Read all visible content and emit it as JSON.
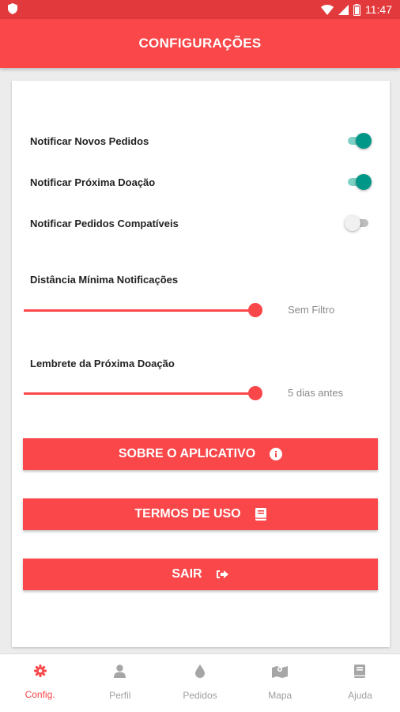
{
  "status": {
    "time": "11:47"
  },
  "appbar": {
    "title": "CONFIGURAÇÕES"
  },
  "settings": {
    "toggles": [
      {
        "label": "Notificar Novos Pedidos",
        "on": true
      },
      {
        "label": "Notificar Próxima Doação",
        "on": true
      },
      {
        "label": "Notificar Pedidos Compatíveis",
        "on": false
      }
    ],
    "distance": {
      "label": "Distância Mínima Notificações",
      "value_text": "Sem Filtro",
      "level": 1.0
    },
    "reminder": {
      "label": "Lembrete da Próxima Doação",
      "value_text": "5 dias antes",
      "level": 1.0
    }
  },
  "buttons": {
    "about": "SOBRE O APLICATIVO",
    "terms": "TERMOS DE USO",
    "exit": "SAIR"
  },
  "nav": [
    {
      "label": "Config.",
      "icon": "gear-icon",
      "active": true
    },
    {
      "label": "Perfil",
      "icon": "person-icon",
      "active": false
    },
    {
      "label": "Pedidos",
      "icon": "drop-icon",
      "active": false
    },
    {
      "label": "Mapa",
      "icon": "map-icon",
      "active": false
    },
    {
      "label": "Ajuda",
      "icon": "book-icon",
      "active": false
    }
  ],
  "colors": {
    "primary": "#f9474a",
    "toggle_on": "#009688",
    "muted": "#9e9e9e"
  }
}
